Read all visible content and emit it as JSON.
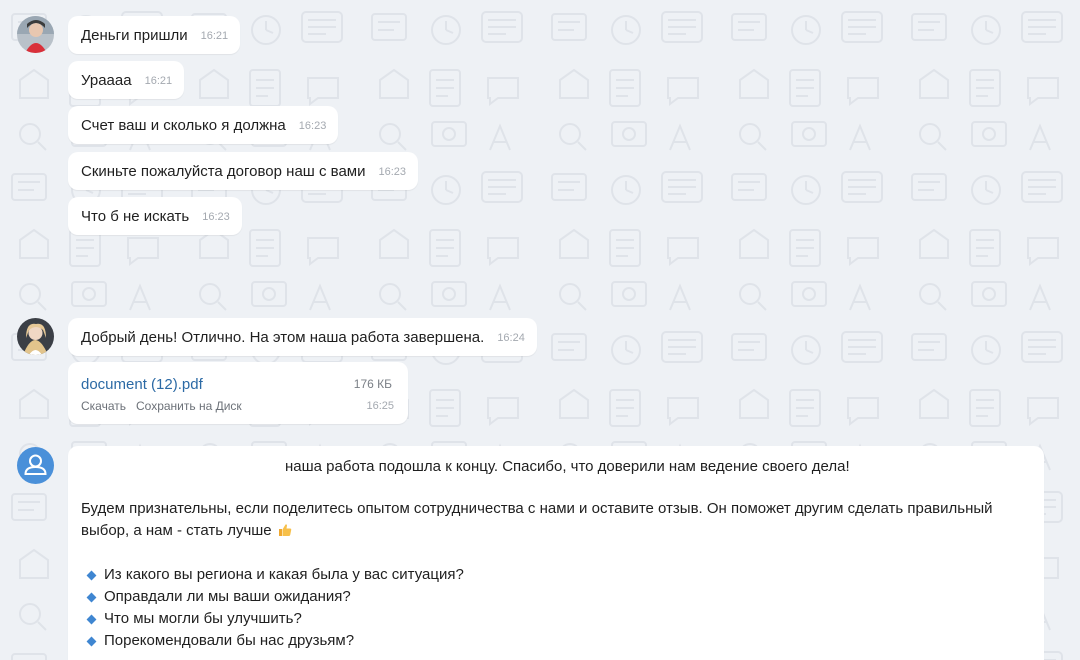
{
  "messages": [
    {
      "text": "Деньги пришли",
      "time": "16:21"
    },
    {
      "text": "Урааaa",
      "time": "16:21"
    },
    {
      "text": "Счет ваш и сколько я должна",
      "time": "16:23"
    },
    {
      "text": "Скиньте пожалуйста договор наш с вами",
      "time": "16:23"
    },
    {
      "text": "Что б не искать",
      "time": "16:23"
    },
    {
      "text": "Добрый день! Отлично. На этом наша работа завершена.",
      "time": "16:24"
    }
  ],
  "file": {
    "name": "document (12).pdf",
    "size": "176 КБ",
    "download_label": "Скачать",
    "save_label": "Сохранить на Диск",
    "time": "16:25"
  },
  "long_message": {
    "line1": "наша работа подошла к концу. Спасибо, что доверили нам ведение своего дела!",
    "paragraph": "Будем признательны, если поделитесь опытом сотрудничества с нами и оставите отзыв. Он поможет другим сделать правильный выбор, а нам - стать лучше",
    "emoji": "thumbs-up",
    "questions": [
      "Из какого вы региона и какая была у вас ситуация?",
      "Оправдали ли мы ваши ожидания?",
      "Что мы могли бы улучшить?",
      "Порекомендовали бы нас друзьям?"
    ]
  },
  "colors": {
    "background": "#eef1f5",
    "bubble": "#ffffff",
    "link": "#2c6aa5",
    "bullet": "#3f86d1",
    "default_avatar": "#4a90d9"
  }
}
